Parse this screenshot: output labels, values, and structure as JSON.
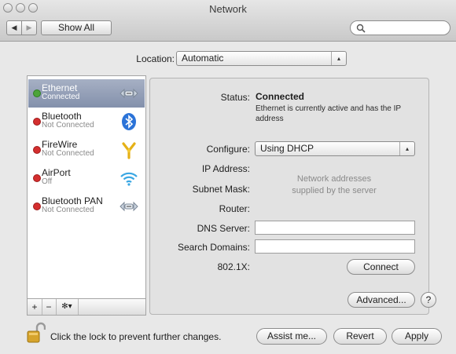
{
  "window": {
    "title": "Network"
  },
  "toolbar": {
    "show_all_label": "Show All",
    "search_placeholder": "",
    "back_icon": "triangle-left-icon",
    "forward_icon": "triangle-right-icon"
  },
  "location": {
    "label": "Location:",
    "value": "Automatic"
  },
  "services": [
    {
      "name": "Ethernet",
      "status": "Connected",
      "status_color": "#4ca43a",
      "icon": "ethernet-icon",
      "selected": true
    },
    {
      "name": "Bluetooth",
      "status": "Not Connected",
      "status_color": "#d42e2e",
      "icon": "bluetooth-icon",
      "selected": false
    },
    {
      "name": "FireWire",
      "status": "Not Connected",
      "status_color": "#d42e2e",
      "icon": "firewire-icon",
      "selected": false
    },
    {
      "name": "AirPort",
      "status": "Off",
      "status_color": "#d42e2e",
      "icon": "airport-icon",
      "selected": false
    },
    {
      "name": "Bluetooth PAN",
      "status": "Not Connected",
      "status_color": "#d42e2e",
      "icon": "bluetooth-pan-icon",
      "selected": false
    }
  ],
  "sidebar_bar": {
    "add_label": "+",
    "remove_label": "−",
    "action_label": "✻▾"
  },
  "details": {
    "status_label": "Status:",
    "status_value": "Connected",
    "status_desc_line1": "Ethernet is currently active and has the IP",
    "status_desc_line2": "address",
    "configure_label": "Configure:",
    "configure_value": "Using DHCP",
    "ip_label": "IP Address:",
    "subnet_label": "Subnet Mask:",
    "router_label": "Router:",
    "dns_label": "DNS Server:",
    "search_domains_label": "Search Domains:",
    "dot1x_label": "802.1X:",
    "server_note_line1": "Network addresses",
    "server_note_line2": "supplied by the server",
    "connect_label": "Connect",
    "advanced_label": "Advanced...",
    "help_label": "?"
  },
  "footer": {
    "lock_text": "Click the lock to prevent further changes.",
    "assist_label": "Assist me...",
    "revert_label": "Revert",
    "apply_label": "Apply"
  }
}
